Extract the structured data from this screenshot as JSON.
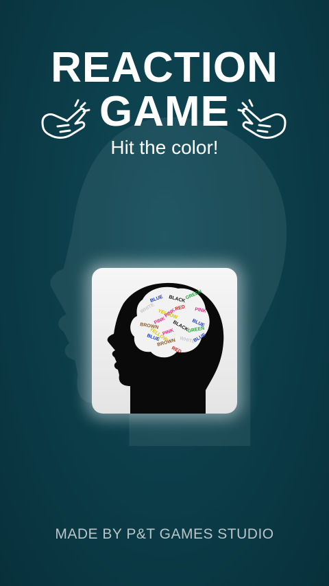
{
  "header": {
    "title_line1": "REACTION",
    "title_line2": "GAME",
    "subtitle": "Hit the color!"
  },
  "logo": {
    "icon": "brain-head-icon",
    "brain_words": [
      "BLUE",
      "BLACK",
      "GREEN",
      "PINK",
      "WHITE",
      "YELLOW",
      "RED",
      "BLUE",
      "BROWN",
      "PINK",
      "BLACK",
      "GREEN",
      "BLUE",
      "PINK",
      "WHITE",
      "BROWN",
      "RED",
      "BLUE",
      "YELLOW",
      "PINK"
    ]
  },
  "footer": {
    "credit": "MADE BY P&T GAMES STUDIO"
  },
  "colors": {
    "background": "#0b3c48",
    "title": "#ffffff",
    "footer": "#b9c5c9",
    "tile": "#eeeeee"
  }
}
